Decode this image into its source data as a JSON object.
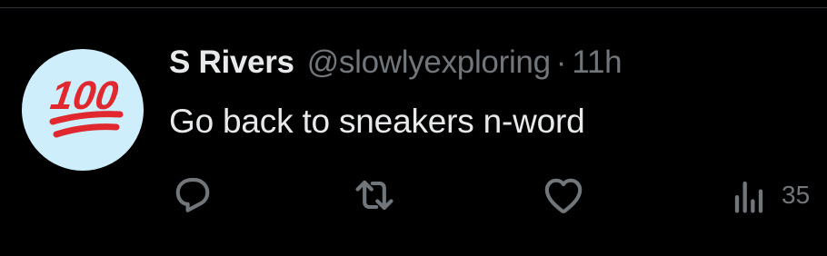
{
  "tweet": {
    "author_name": "S Rivers",
    "author_handle": "@slowlyexploring",
    "separator": "·",
    "time_ago": "11h",
    "text": "Go back to sneakers n-word",
    "avatar": {
      "icon": "hundred-points-emoji",
      "text": "100",
      "background_color": "#cdeefa",
      "emoji_color": "#e0282e"
    },
    "actions": {
      "reply": {
        "icon": "reply-icon"
      },
      "retweet": {
        "icon": "retweet-icon"
      },
      "like": {
        "icon": "heart-icon"
      },
      "views": {
        "icon": "views-icon",
        "count": "35"
      }
    }
  },
  "colors": {
    "background": "#000000",
    "primary_text": "#e7e9ea",
    "secondary_text": "#71767b",
    "divider": "#2f3336"
  }
}
